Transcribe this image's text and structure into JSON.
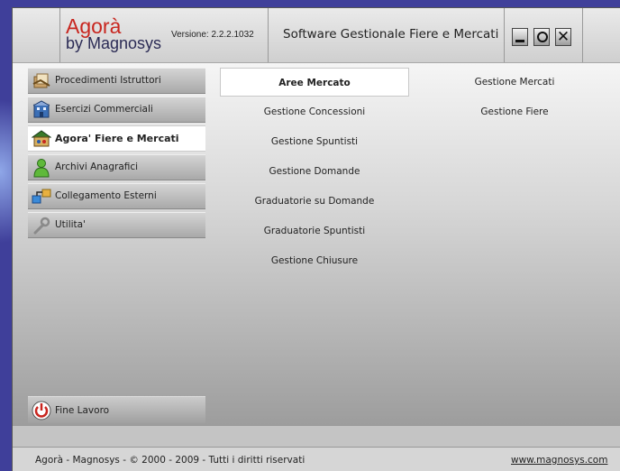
{
  "header": {
    "logo_title": "Agorà",
    "logo_subtitle": "by Magnosys",
    "version": "Versione: 2.2.2.1032",
    "app_title": "Software Gestionale Fiere e Mercati",
    "window_buttons": [
      "minimize-icon",
      "maximize-icon",
      "close-icon"
    ]
  },
  "sidebar": {
    "items": [
      {
        "label": "Procedimenti Istruttori",
        "icon": "documents-icon",
        "active": false
      },
      {
        "label": "Esercizi Commerciali",
        "icon": "building-icon",
        "active": false
      },
      {
        "label": "Agora'  Fiere e Mercati",
        "icon": "market-icon",
        "active": true
      },
      {
        "label": "Archivi Anagrafici",
        "icon": "user-icon",
        "active": false
      },
      {
        "label": "Collegamento Esterni",
        "icon": "network-icon",
        "active": false
      },
      {
        "label": "Utilita'",
        "icon": "wrench-icon",
        "active": false
      }
    ],
    "exit": {
      "label": "Fine Lavoro",
      "icon": "power-icon"
    }
  },
  "menu": {
    "middle": [
      {
        "label": "Aree Mercato",
        "selected": true
      },
      {
        "label": "Gestione Concessioni"
      },
      {
        "label": "Gestione Spuntisti"
      },
      {
        "label": "Gestione Domande"
      },
      {
        "label": "Graduatorie su Domande"
      },
      {
        "label": "Graduatorie Spuntisti"
      },
      {
        "label": "Gestione Chiusure"
      }
    ],
    "right": [
      {
        "label": "Gestione Mercati"
      },
      {
        "label": "Gestione Fiere"
      }
    ]
  },
  "footer": {
    "copyright": "Agorà  -  Magnosys -  © 2000 - 2009  -  Tutti i diritti riservati",
    "link": "www.magnosys.com"
  },
  "colors": {
    "accent_red": "#c8261f",
    "desktop_blue": "#3f3f9a"
  }
}
